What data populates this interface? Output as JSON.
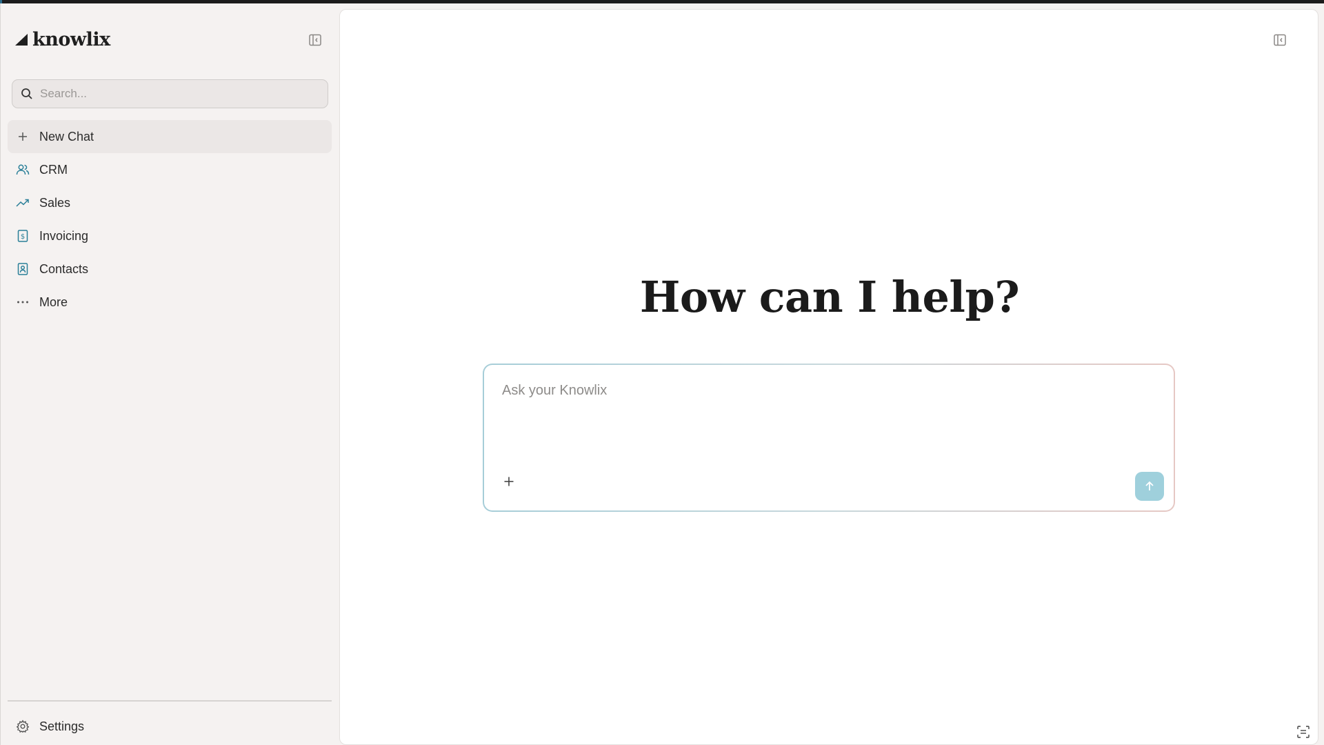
{
  "brand": {
    "name": "knowlix"
  },
  "sidebar": {
    "search_placeholder": "Search...",
    "items": [
      {
        "label": "New Chat",
        "icon": "plus-icon",
        "active": true
      },
      {
        "label": "CRM",
        "icon": "users-icon"
      },
      {
        "label": "Sales",
        "icon": "trending-up-icon"
      },
      {
        "label": "Invoicing",
        "icon": "invoice-icon"
      },
      {
        "label": "Contacts",
        "icon": "contacts-icon"
      },
      {
        "label": "More",
        "icon": "ellipsis-icon"
      }
    ],
    "settings_label": "Settings"
  },
  "main": {
    "headline": "How can I help?",
    "composer_placeholder": "Ask your Knowlix"
  },
  "colors": {
    "sidebar_bg": "#f5f2f1",
    "accent": "#2a7f98",
    "send_button": "#9fd0dc"
  }
}
